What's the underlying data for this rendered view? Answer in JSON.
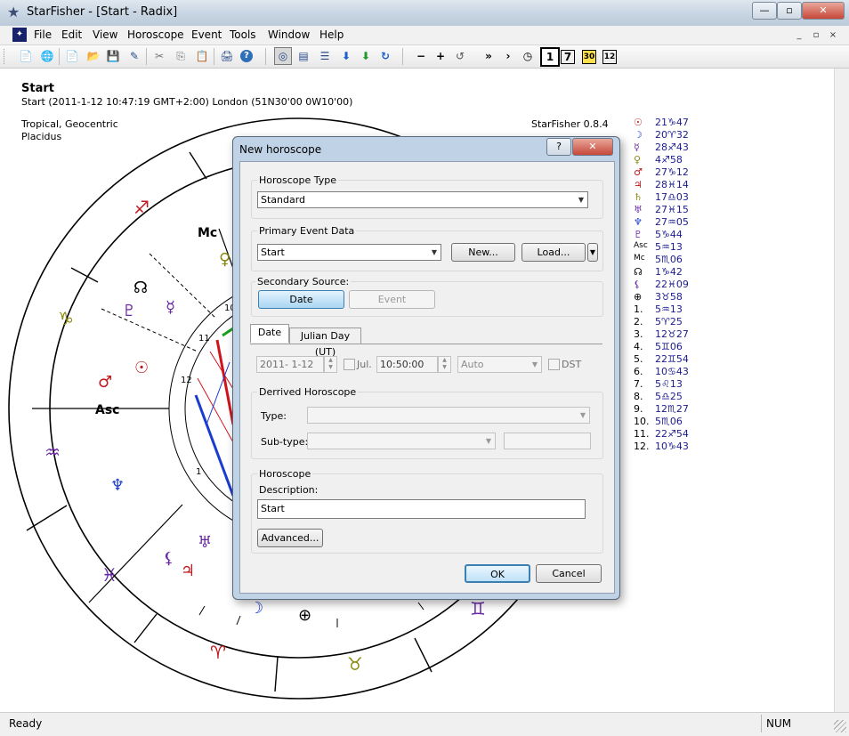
{
  "window": {
    "title": "StarFisher - [Start - Radix]",
    "min": "—",
    "max": "▫",
    "close": "✕"
  },
  "menu": [
    "File",
    "Edit",
    "View",
    "Horoscope",
    "Event",
    "Tools",
    "Window",
    "Help"
  ],
  "mdi_buttons": [
    "_",
    "▫",
    "×"
  ],
  "toolbar": {
    "group1": [
      "📄",
      "🌐",
      "📄",
      "📂",
      "💾",
      "✎",
      "✂",
      "⎘",
      "📋",
      "🖨",
      "?"
    ],
    "group2": [
      "◎",
      "▤",
      "☰",
      "⬇",
      "⬇",
      "↻"
    ],
    "group3": [
      "−",
      "+",
      "↺",
      "»",
      "›",
      "◷",
      "1",
      "7",
      "30",
      "12"
    ]
  },
  "chart_header": {
    "name": "Start",
    "event": "Start (2011-1-12 10:47:19 GMT+2:00) London (51N30'00 0W10'00)",
    "zodiac": "Tropical, Geocentric",
    "houses": "Placidus",
    "version": "StarFisher 0.8.4"
  },
  "wheel_labels": {
    "mc": "Mc",
    "asc": "Asc",
    "house_nums": [
      "1",
      "11",
      "12"
    ],
    "signs": [
      "♐",
      "♑",
      "♒",
      "♓",
      "♈",
      "♉",
      "♊"
    ],
    "planets": [
      "♀",
      "☊",
      "♇",
      "☿",
      "☉",
      "♂",
      "♆",
      "♅",
      "⚸",
      "♃",
      "☽",
      "⊕"
    ],
    "point_signs": [
      "♂"
    ]
  },
  "planet_list": [
    {
      "glyph": "☉",
      "value": "21♑47"
    },
    {
      "glyph": "☽",
      "value": "20♈32"
    },
    {
      "glyph": "☿",
      "value": "28♐43"
    },
    {
      "glyph": "♀",
      "value": "4♐58"
    },
    {
      "glyph": "♂",
      "value": "27♑12"
    },
    {
      "glyph": "♃",
      "value": "28♓14"
    },
    {
      "glyph": "♄",
      "value": "17♎03"
    },
    {
      "glyph": "♅",
      "value": "27♓15"
    },
    {
      "glyph": "♆",
      "value": "27♒05"
    },
    {
      "glyph": "♇",
      "value": "5♑44"
    },
    {
      "glyph": "Asc",
      "value": "5♒13"
    },
    {
      "glyph": "Mc",
      "value": "5♏06"
    },
    {
      "glyph": "☊",
      "value": "1♑42"
    },
    {
      "glyph": "⚸",
      "value": "22♓09"
    },
    {
      "glyph": "⊕",
      "value": "3♉58"
    },
    {
      "glyph": "1.",
      "value": "5♒13"
    },
    {
      "glyph": "2.",
      "value": "5♈25"
    },
    {
      "glyph": "3.",
      "value": "12♉27"
    },
    {
      "glyph": "4.",
      "value": "5♊06"
    },
    {
      "glyph": "5.",
      "value": "22♊54"
    },
    {
      "glyph": "6.",
      "value": "10♋43"
    },
    {
      "glyph": "7.",
      "value": "5♌13"
    },
    {
      "glyph": "8.",
      "value": "5♎25"
    },
    {
      "glyph": "9.",
      "value": "12♏27"
    },
    {
      "glyph": "10.",
      "value": "5♏06"
    },
    {
      "glyph": "11.",
      "value": "22♐54"
    },
    {
      "glyph": "12.",
      "value": "10♑43"
    }
  ],
  "dialog": {
    "title": "New horoscope",
    "help_btn": "?",
    "close_btn": "✕",
    "horoscope_type": {
      "label": "Horoscope Type",
      "value": "Standard"
    },
    "primary_event": {
      "label": "Primary Event Data",
      "value": "Start",
      "new_btn": "New...",
      "load_btn": "Load..."
    },
    "secondary": {
      "label": "Secondary Source:",
      "date_btn": "Date",
      "event_btn": "Event"
    },
    "tabs": [
      "Date",
      "Julian Day (UT)"
    ],
    "date_row": {
      "date": "2011- 1-12",
      "jul": "Jul.",
      "time": "10:50:00",
      "tz": "Auto",
      "dst": "DST"
    },
    "derived": {
      "label": "Derrived Horoscope",
      "type_label": "Type:",
      "subtype_label": "Sub-type:"
    },
    "horoscope": {
      "label": "Horoscope",
      "desc_label": "Description:",
      "desc_value": "Start",
      "advanced_btn": "Advanced..."
    },
    "ok": "OK",
    "cancel": "Cancel"
  },
  "status": {
    "text": "Ready",
    "num": "NUM"
  },
  "colors": {
    "title_blue": "#1b1b8f",
    "glyph_red": "#c0181c",
    "glyph_purple": "#6a2aa8",
    "glyph_olive": "#8a8a10"
  }
}
